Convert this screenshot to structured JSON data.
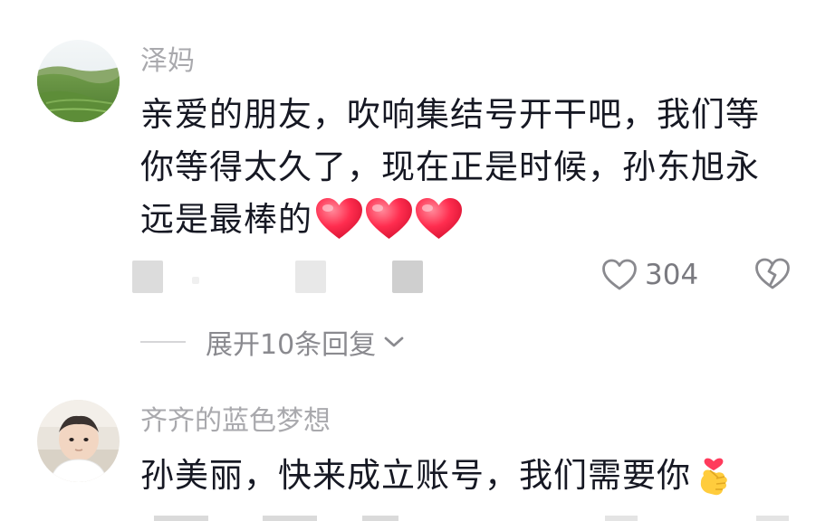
{
  "comments": [
    {
      "username": "泽妈",
      "text_lines": [
        "亲爱的朋友，吹响集结号开干吧，我们等",
        "你等得太久了，现在正是时候，孙东旭永",
        "远是最棒的"
      ],
      "emoji": "heart-icon x3",
      "like_count": "304",
      "expand_replies": "展开10条回复"
    },
    {
      "username": "齐齐的蓝色梦想",
      "text_lines": [
        "孙美丽，快来成立账号，我们需要你"
      ],
      "emoji": "finger-heart-icon"
    }
  ],
  "colors": {
    "username": "#a9a9ad",
    "text": "#161823",
    "meta": "#7a7a80",
    "heart": "#ff2d4f"
  }
}
